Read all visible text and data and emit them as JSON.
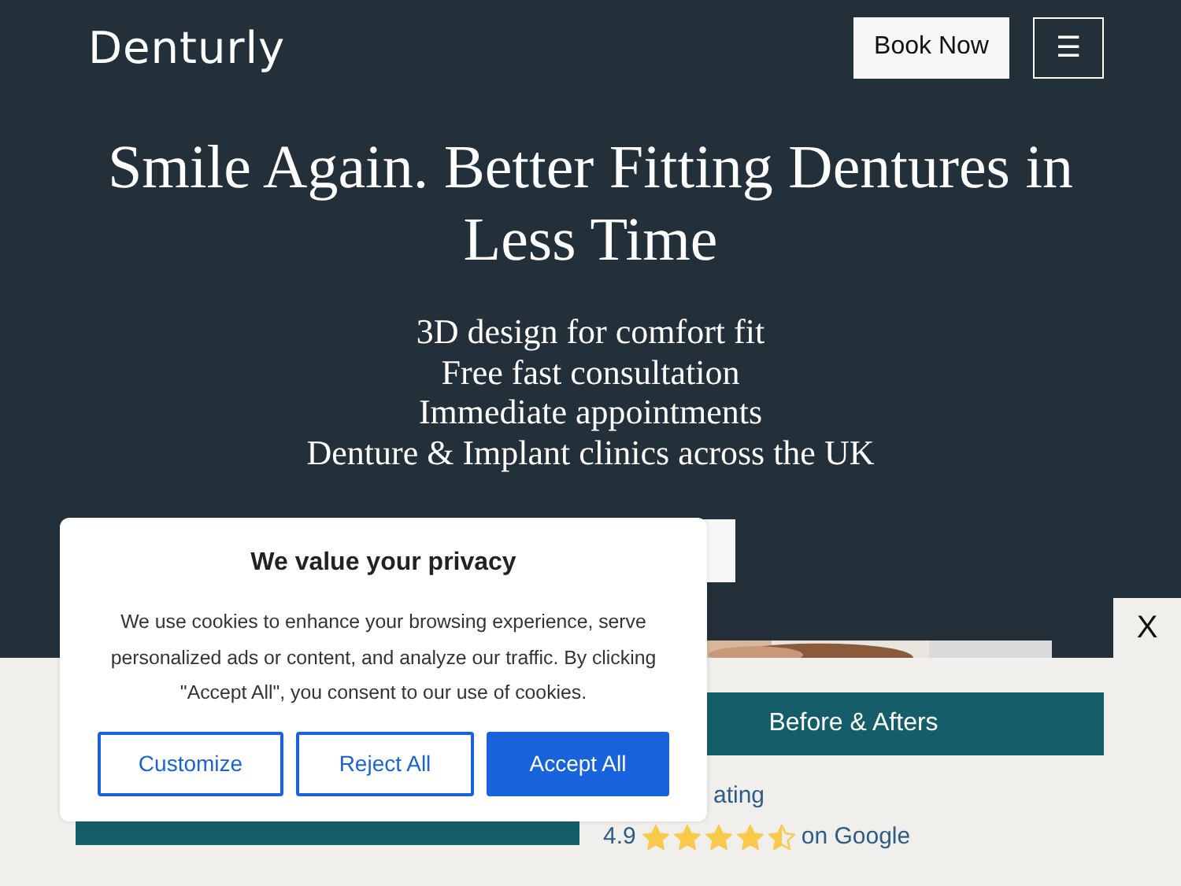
{
  "header": {
    "logo": "Denturly",
    "book_button": "Book Now",
    "menu_icon": "☰"
  },
  "hero": {
    "title": "Smile Again. Better Fitting Dentures in Less Time",
    "lines": [
      "3D design for comfort fit",
      "Free fast consultation",
      "Immediate appointments",
      "Denture & Implant clinics across the UK"
    ]
  },
  "bottom_bar": {
    "close": "X",
    "before_afters": "Before & Afters",
    "rating_label": "ating",
    "rating_value": "4.9",
    "stars": 4.5,
    "rating_source": "on Google"
  },
  "cookie_banner": {
    "title": "We value your privacy",
    "text": "We use cookies to enhance your browsing experience, serve personalized ads or content, and analyze our traffic. By clicking \"Accept All\", you consent to our use of cookies.",
    "buttons": [
      {
        "label": "Customize",
        "kind": "outline"
      },
      {
        "label": "Reject All",
        "kind": "outline"
      },
      {
        "label": "Accept All",
        "kind": "solid"
      }
    ]
  }
}
